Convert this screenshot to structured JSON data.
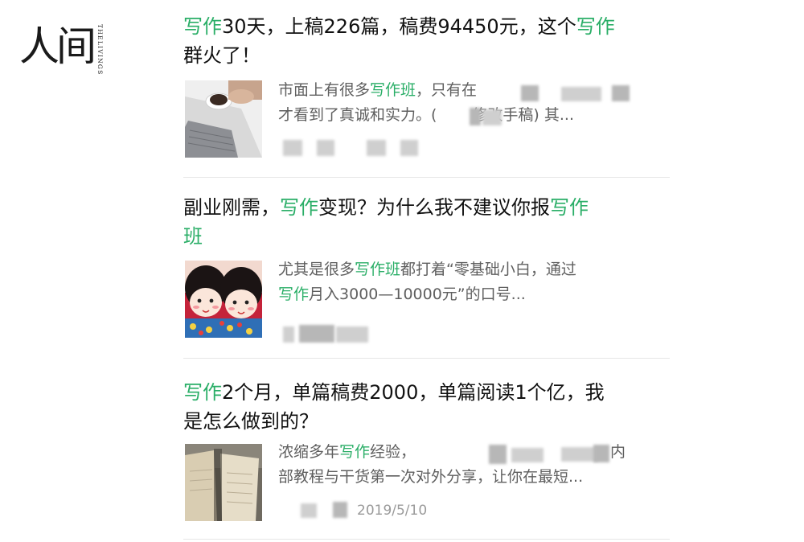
{
  "brand": {
    "logo_text": "人间",
    "logo_sub": [
      "THE",
      "LIVINGS"
    ]
  },
  "accent_color": "#2aae67",
  "articles": [
    {
      "title_parts": [
        {
          "text": "写作",
          "hl": true
        },
        {
          "text": "30天，上稿226篇，稿费94450元，这个",
          "hl": false
        },
        {
          "text": "写作",
          "hl": true
        },
        {
          "text": "群火了！",
          "hl": false
        }
      ],
      "snippet_parts": [
        {
          "text": "市面上有很多",
          "hl": false
        },
        {
          "text": "写作班",
          "hl": true
        },
        {
          "text": "，只有在",
          "hl": false
        },
        {
          "text": "才看到了真诚和实力。(",
          "hl": false
        },
        {
          "text": "修改手稿) 其...",
          "hl": false
        }
      ],
      "thumb": "laptop-coffee-photo"
    },
    {
      "title_parts": [
        {
          "text": "副业刚需，",
          "hl": false
        },
        {
          "text": "写作",
          "hl": true
        },
        {
          "text": "变现？为什么我不建议你报",
          "hl": false
        },
        {
          "text": "写作",
          "hl": true
        },
        {
          "text": "班",
          "hl": true
        }
      ],
      "snippet_parts": [
        {
          "text": "尤其是很多",
          "hl": false
        },
        {
          "text": "写作班",
          "hl": true
        },
        {
          "text": "都打着“零基础小白，通过",
          "hl": false
        },
        {
          "text": "写作",
          "hl": true
        },
        {
          "text": "月入3000—10000元”的口号...",
          "hl": false
        }
      ],
      "thumb": "cartoon-dolls-illustration"
    },
    {
      "title_parts": [
        {
          "text": "写作",
          "hl": true
        },
        {
          "text": "2个月，单篇稿费2000，单篇阅读1个亿，我",
          "hl": false
        },
        {
          "text": "是怎么做到的？",
          "hl": false
        }
      ],
      "snippet_parts": [
        {
          "text": "浓缩多年",
          "hl": false
        },
        {
          "text": "写作",
          "hl": true
        },
        {
          "text": "经验，",
          "hl": false
        },
        {
          "text": "内",
          "hl": false
        },
        {
          "text": "部教程与干货第一次对外分享，让你在最短...",
          "hl": false
        }
      ],
      "date": "2019/5/10",
      "thumb": "notebook-pages-photo"
    }
  ]
}
